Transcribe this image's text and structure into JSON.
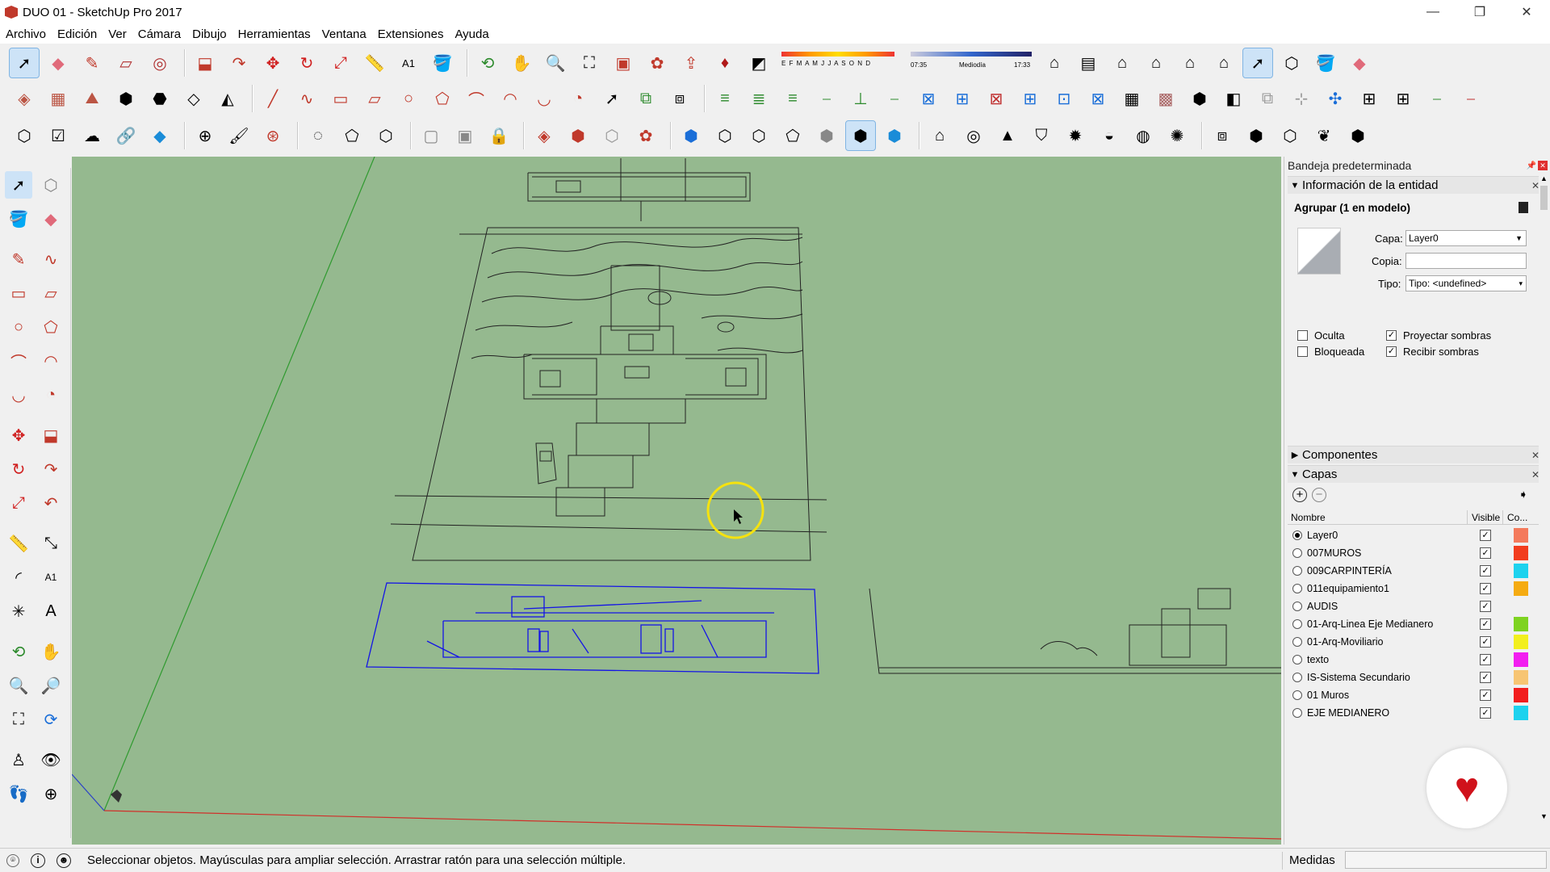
{
  "window": {
    "title": "DUO 01 - SketchUp Pro 2017",
    "controls": [
      "—",
      "❐",
      "✕"
    ]
  },
  "menu": [
    "Archivo",
    "Edición",
    "Ver",
    "Cámara",
    "Dibujo",
    "Herramientas",
    "Ventana",
    "Extensiones",
    "Ayuda"
  ],
  "shadow_bar": {
    "months": "E F M A M J J A S O N D",
    "time_start": "07:35",
    "time_mid": "Mediodía",
    "time_end": "17:33"
  },
  "tray": {
    "title": "Bandeja predeterminada",
    "entity_info": {
      "header": "Información de la entidad",
      "selection": "Agrupar (1 en modelo)",
      "layer_label": "Capa:",
      "layer_value": "Layer0",
      "instance_label": "Copia:",
      "instance_value": "",
      "type_label": "Tipo:",
      "type_value": "Tipo: <undefined>",
      "hidden_label": "Oculta",
      "hidden": false,
      "locked_label": "Bloqueada",
      "locked": false,
      "cast_shadows_label": "Proyectar sombras",
      "cast_shadows": true,
      "receive_shadows_label": "Recibir sombras",
      "receive_shadows": true
    },
    "components_header": "Componentes",
    "layers": {
      "header": "Capas",
      "col_name": "Nombre",
      "col_visible": "Visible",
      "col_color": "Co...",
      "rows": [
        {
          "name": "Layer0",
          "active": true,
          "visible": true,
          "color": "#f47a5c"
        },
        {
          "name": "007MUROS",
          "active": false,
          "visible": true,
          "color": "#f23d1e"
        },
        {
          "name": "009CARPINTERÍA",
          "active": false,
          "visible": true,
          "color": "#1ed2ee"
        },
        {
          "name": "011equipamiento1",
          "active": false,
          "visible": true,
          "color": "#f5ab12"
        },
        {
          "name": "AUDIS",
          "active": false,
          "visible": true,
          "color": ""
        },
        {
          "name": "01-Arq-Linea Eje Medianero",
          "active": false,
          "visible": true,
          "color": "#7ed321"
        },
        {
          "name": "01-Arq-Moviliario",
          "active": false,
          "visible": true,
          "color": "#f2ef1e"
        },
        {
          "name": "texto",
          "active": false,
          "visible": true,
          "color": "#f21ef0"
        },
        {
          "name": "IS-Sistema Secundario",
          "active": false,
          "visible": true,
          "color": "#f7c573"
        },
        {
          "name": "01 Muros",
          "active": false,
          "visible": true,
          "color": "#f21e1e"
        },
        {
          "name": "EJE MEDIANERO",
          "active": false,
          "visible": true,
          "color": "#1ed2ee"
        }
      ]
    }
  },
  "status": {
    "message": "Seleccionar objetos. Mayúsculas para ampliar selección. Arrastrar ratón para una selección múltiple.",
    "measurements_label": "Medidas",
    "measurements_value": ""
  },
  "colors": {
    "viewport_bg": "#95b98f",
    "selection_blue": "#1414e6",
    "axis_red": "#d0302a",
    "axis_green": "#2f9a2f",
    "cursor_highlight": "#f5e20f"
  }
}
